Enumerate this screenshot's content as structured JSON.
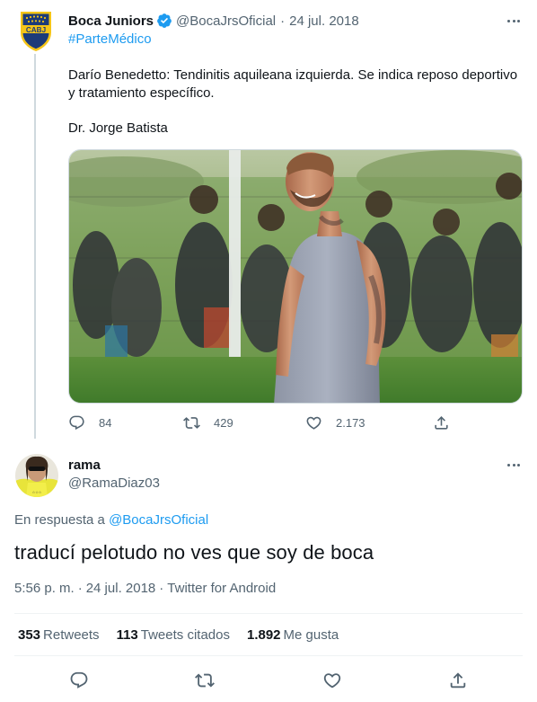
{
  "parent_tweet": {
    "author_name": "Boca Juniors",
    "author_handle": "@BocaJrsOficial",
    "separator": "·",
    "date": "24 jul. 2018",
    "hashtag": "#ParteMédico",
    "text": "Darío Benedetto: Tendinitis aquileana izquierda. Se indica reposo deportivo y tratamiento específico.",
    "signature": "Dr. Jorge Batista",
    "avatar_badge_text": "CABJ",
    "stats": {
      "replies": "84",
      "retweets": "429",
      "likes": "2.173"
    },
    "icons": {
      "reply": "reply-icon",
      "retweet": "retweet-icon",
      "like": "heart-icon",
      "share": "share-icon",
      "verified": "verified-badge-icon",
      "more": "more-icon"
    }
  },
  "reply_tweet": {
    "author_name": "rama",
    "author_handle": "@RamaDiaz03",
    "reply_prefix": "En respuesta a",
    "reply_to": "@BocaJrsOficial",
    "text": "traducí pelotudo no ves que soy de boca",
    "time": "5:56 p. m.",
    "separator": "·",
    "date": "24 jul. 2018",
    "source": "Twitter for Android",
    "retweets_count": "353",
    "retweets_label": "Retweets",
    "quotes_count": "113",
    "quotes_label": "Tweets citados",
    "likes_count": "1.892",
    "likes_label": "Me gusta"
  },
  "colors": {
    "accent": "#1d9bf0",
    "text_primary": "#0f1419",
    "text_secondary": "#536471",
    "boca_blue": "#1c3b79",
    "boca_gold": "#f5c518"
  }
}
